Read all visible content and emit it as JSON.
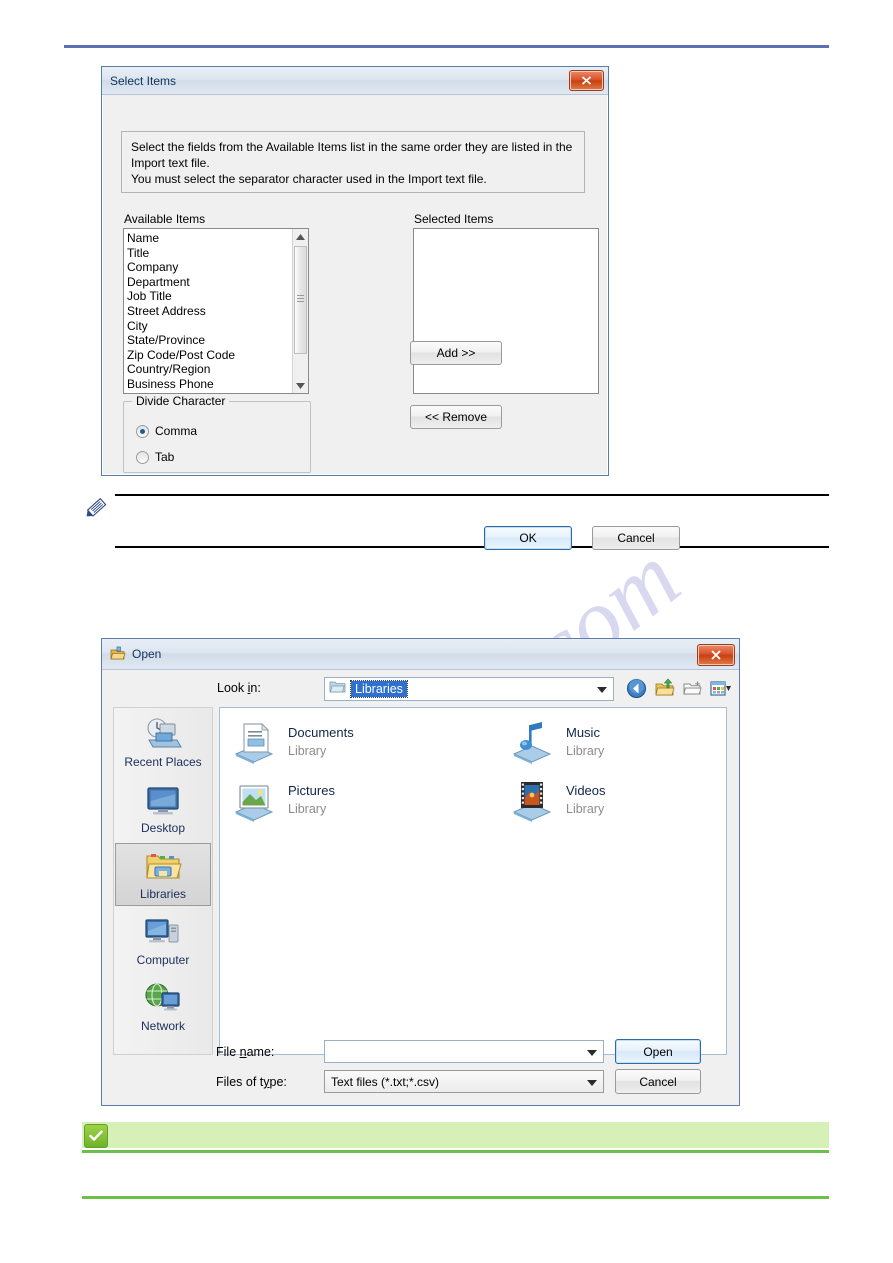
{
  "page": {
    "rules": {
      "top_rule_color": "#5d6fb5",
      "tip_rule_color": "#6cc04a",
      "note_rule_color": "#000000"
    },
    "watermark_text": "manualshive.com"
  },
  "select_items_dialog": {
    "title": "Select Items",
    "close_label": "✕",
    "instructions": [
      "Select the fields from the Available Items list in the same order they are listed in the",
      "Import text file.",
      "You must select the separator character used in the Import text file."
    ],
    "available_label": "Available Items",
    "selected_label": "Selected Items",
    "available_items": [
      "Name",
      "Title",
      "Company",
      "Department",
      "Job Title",
      "Street Address",
      "City",
      "State/Province",
      "Zip Code/Post Code",
      "Country/Region",
      "Business Phone"
    ],
    "selected_items": [],
    "add_label": "Add >>",
    "remove_label": "<< Remove",
    "divide_character": {
      "legend": "Divide Character",
      "options": [
        {
          "label": "Comma",
          "checked": true
        },
        {
          "label": "Tab",
          "checked": false
        }
      ]
    },
    "ok_label": "OK",
    "cancel_label": "Cancel"
  },
  "open_dialog": {
    "title": "Open",
    "close_label": "✕",
    "lookin_label": "Look in:",
    "lookin_value": "Libraries",
    "toolbar": [
      {
        "name": "back-icon",
        "tooltip": "Back"
      },
      {
        "name": "up-folder-icon",
        "tooltip": "Up one level"
      },
      {
        "name": "new-folder-icon",
        "tooltip": "New folder"
      },
      {
        "name": "views-icon",
        "tooltip": "Views"
      }
    ],
    "places": [
      {
        "label": "Recent Places",
        "icon": "recent-places-icon",
        "selected": false
      },
      {
        "label": "Desktop",
        "icon": "desktop-icon",
        "selected": false
      },
      {
        "label": "Libraries",
        "icon": "libraries-icon",
        "selected": true
      },
      {
        "label": "Computer",
        "icon": "computer-icon",
        "selected": false
      },
      {
        "label": "Network",
        "icon": "network-icon",
        "selected": false
      }
    ],
    "libraries": [
      {
        "name": "Documents",
        "sub": "Library",
        "icon": "documents-library-icon"
      },
      {
        "name": "Music",
        "sub": "Library",
        "icon": "music-library-icon"
      },
      {
        "name": "Pictures",
        "sub": "Library",
        "icon": "pictures-library-icon"
      },
      {
        "name": "Videos",
        "sub": "Library",
        "icon": "videos-library-icon"
      }
    ],
    "filename_label": "File name:",
    "filename_value": "",
    "filetype_label": "Files of type:",
    "filetype_value": "Text files (*.txt;*.csv)",
    "open_label": "Open",
    "cancel_label": "Cancel"
  },
  "note_callout": {
    "icon": "pencil-note-icon",
    "text": ""
  },
  "tip_callout": {
    "icon": "green-check-icon",
    "text": ""
  }
}
